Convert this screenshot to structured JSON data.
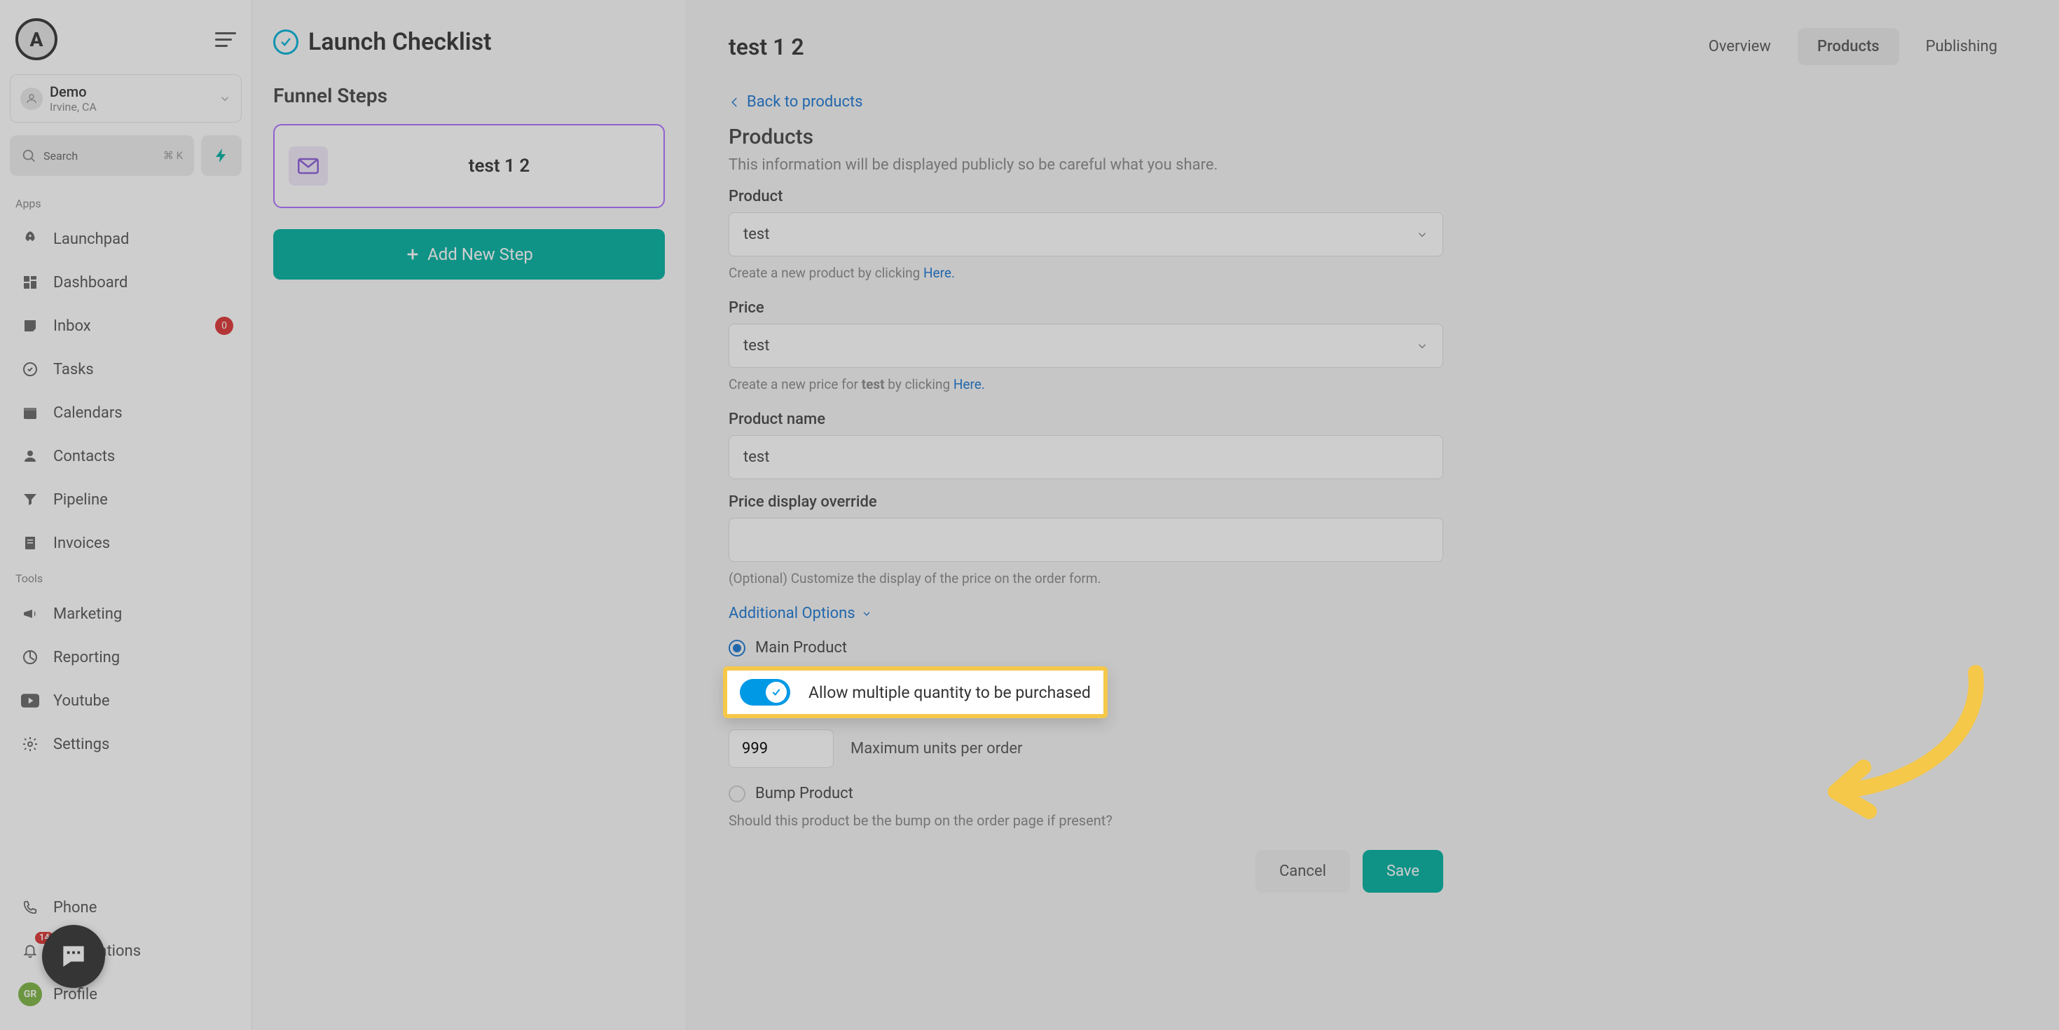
{
  "sidebar": {
    "logo_letter": "A",
    "account": {
      "name": "Demo",
      "location": "Irvine, CA"
    },
    "search": {
      "label": "Search",
      "shortcut": "⌘ K"
    },
    "apps_label": "Apps",
    "tools_label": "Tools",
    "nav": {
      "launchpad": "Launchpad",
      "dashboard": "Dashboard",
      "inbox": "Inbox",
      "inbox_badge": "0",
      "tasks": "Tasks",
      "calendars": "Calendars",
      "contacts": "Contacts",
      "pipeline": "Pipeline",
      "invoices": "Invoices",
      "marketing": "Marketing",
      "reporting": "Reporting",
      "youtube": "Youtube",
      "settings": "Settings"
    },
    "bottom": {
      "phone": "Phone",
      "notifications": "Notifications",
      "notifications_badge": "14",
      "profile": "Profile",
      "profile_initials": "GR"
    }
  },
  "midcol": {
    "launch_title": "Launch Checklist",
    "funnel_title": "Funnel Steps",
    "step1": "test 1 2",
    "add_step": "Add New Step"
  },
  "main": {
    "page_title": "test 1 2",
    "tabs": {
      "overview": "Overview",
      "products": "Products",
      "publishing": "Publishing"
    },
    "back_link": "Back to products",
    "section_title": "Products",
    "section_sub": "This information will be displayed publicly so be careful what you share.",
    "product_label": "Product",
    "product_value": "test",
    "product_helper_pre": "Create a new product by clicking ",
    "product_helper_link": "Here.",
    "price_label": "Price",
    "price_value": "test",
    "price_helper_pre": "Create a new price for ",
    "price_helper_bold": "test",
    "price_helper_post": " by clicking ",
    "price_helper_link": "Here.",
    "name_label": "Product name",
    "name_value": "test",
    "override_label": "Price display override",
    "override_helper": "(Optional) Customize the display of the price on the order form.",
    "additional_options": "Additional Options",
    "main_product": "Main Product",
    "allow_qty": "Allow multiple quantity to be purchased",
    "max_units_value": "999",
    "max_units_label": "Maximum units per order",
    "bump_product": "Bump Product",
    "bump_helper": "Should this product be the bump on the order page if present?",
    "cancel": "Cancel",
    "save": "Save"
  }
}
